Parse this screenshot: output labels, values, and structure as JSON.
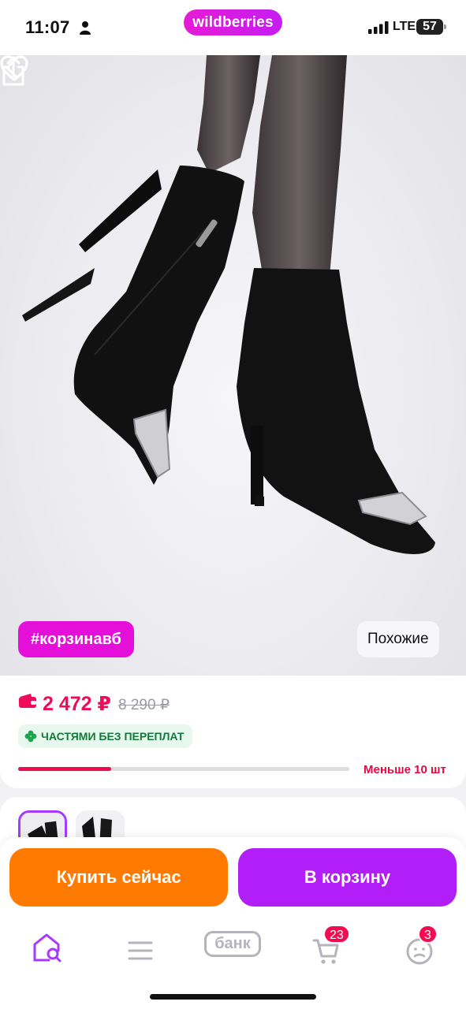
{
  "status_bar": {
    "time": "11:07",
    "network": "LTE",
    "battery": "57",
    "app_logo": "wildberries",
    "icons": [
      "person-icon",
      "signal-icon"
    ]
  },
  "product_photo": {
    "nav": {
      "back_icon": "chevron-left-icon",
      "favorite_icon": "heart-icon",
      "share_icon": "share-icon"
    },
    "hashtag_chip": "#корзинавб",
    "similar_chip": "Похожие"
  },
  "price_card": {
    "wallet_icon": "wallet-icon",
    "price": "2 472 ₽",
    "old_price": "8 290 ₽",
    "installment": "ЧАСТЯМИ БЕЗ ПЕРЕПЛАТ",
    "stock_level": 0.28,
    "stock_label": "Меньше 10 шт",
    "colors": {
      "price": "#f00a5a",
      "stock": "#f00a4e",
      "installment": "#117a3a"
    }
  },
  "variants": {
    "count_visible": 2,
    "selected_index": 0
  },
  "actions": {
    "buy_now_label": "Купить сейчас",
    "add_to_cart_label": "В корзину",
    "colors": {
      "buy_now": "#ff7a00",
      "add_to_cart": "#b21ef7"
    }
  },
  "tab_bar": {
    "tabs": [
      {
        "icon": "home-search-icon",
        "active": true
      },
      {
        "icon": "menu-icon",
        "active": false
      },
      {
        "icon": "bank-icon",
        "label": "банк",
        "active": false
      },
      {
        "icon": "cart-icon",
        "badge": "23",
        "active": false
      },
      {
        "icon": "profile-icon",
        "badge": "3",
        "active": false
      }
    ]
  },
  "theme": {
    "brand": "#cb11ab",
    "accent_purple": "#a73afd"
  }
}
